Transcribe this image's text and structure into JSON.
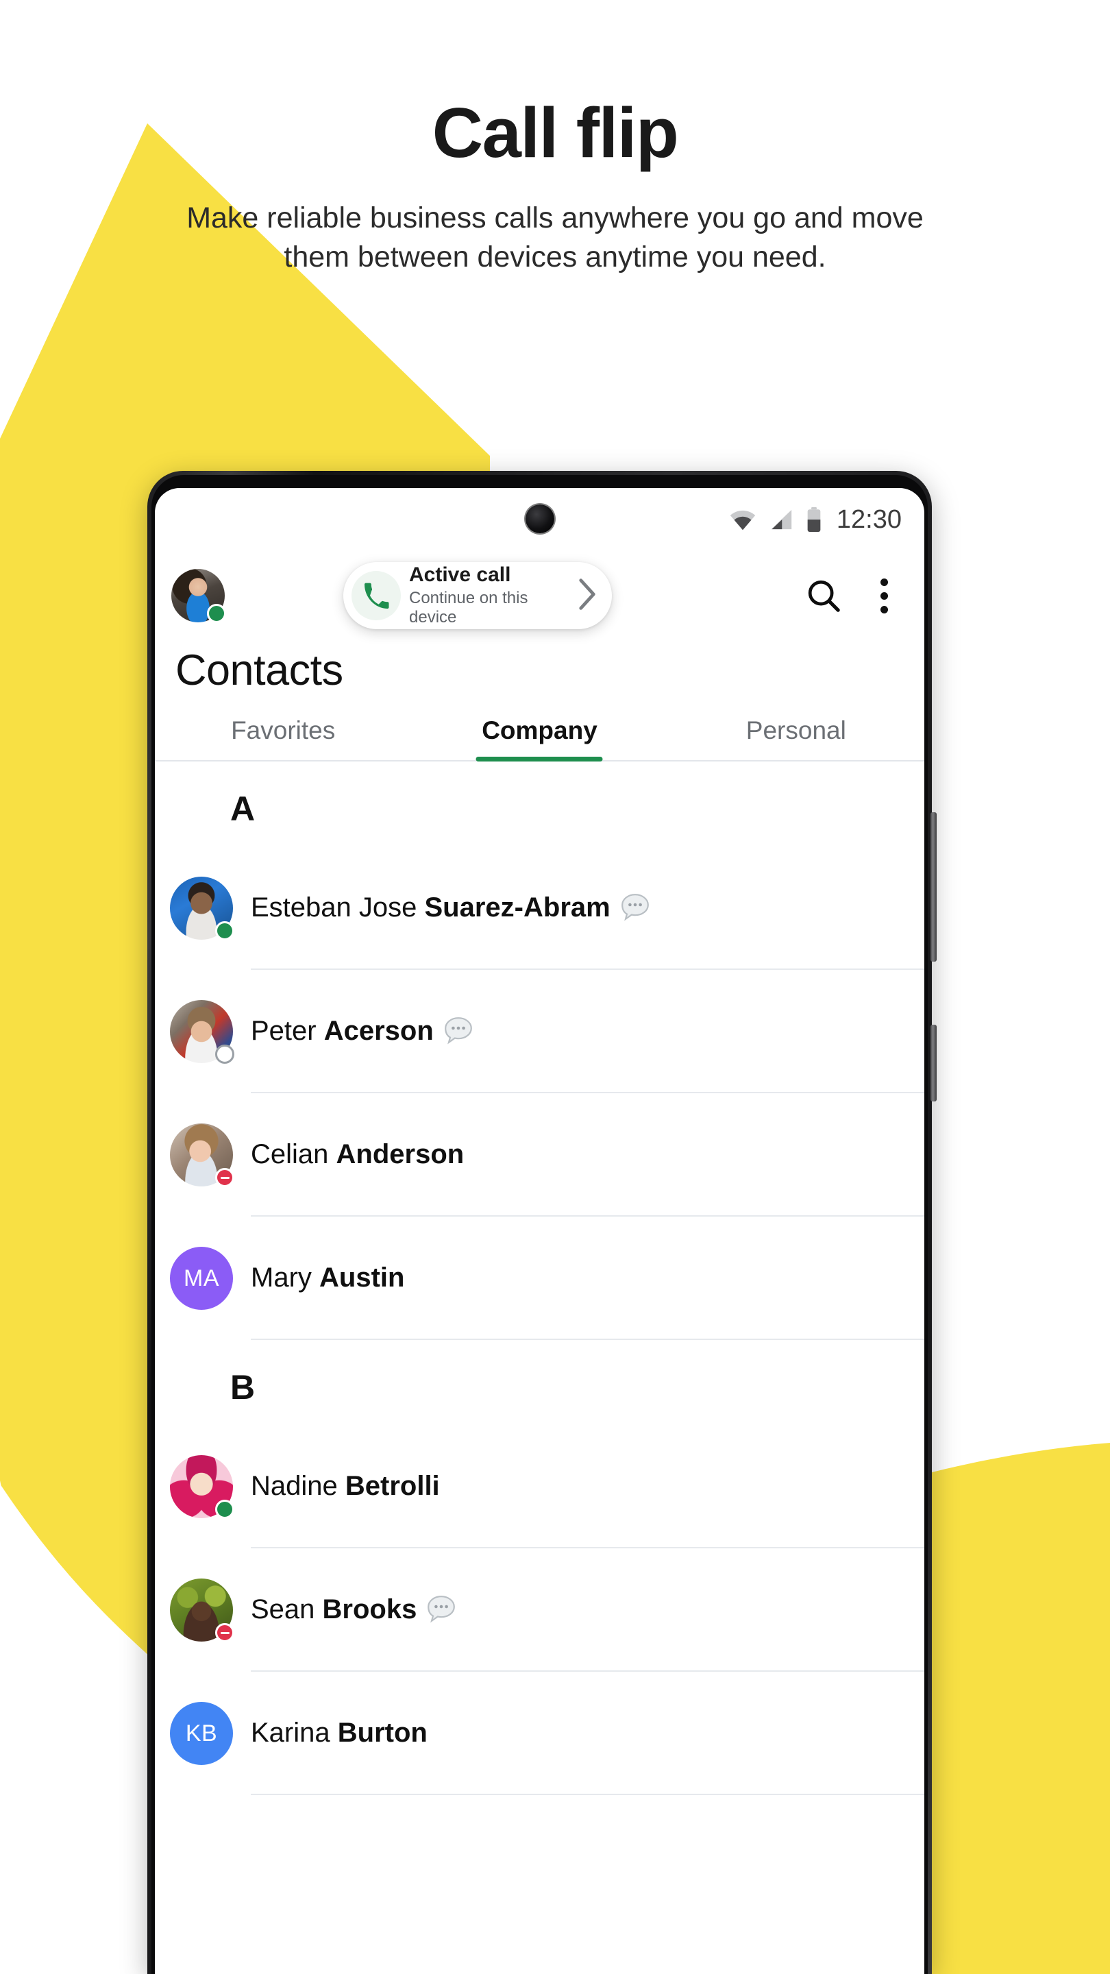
{
  "hero": {
    "title": "Call flip",
    "subtitle": "Make reliable business calls anywhere you go and move them between devices anytime you need."
  },
  "colors": {
    "accent_yellow": "#F8E044",
    "accent_green": "#1E8E4E",
    "text_primary": "#111111",
    "text_secondary": "#5F6368",
    "divider": "#E6E9ED",
    "dnd_red": "#E0324B"
  },
  "phone": {
    "status_bar": {
      "time": "12:30",
      "icons": [
        "wifi-icon",
        "cellular-signal-icon",
        "battery-icon"
      ],
      "battery_level": "50%"
    },
    "app_bar": {
      "profile_avatar": {
        "name": "me-avatar",
        "presence": "online"
      },
      "active_call_chip": {
        "icon": "phone-icon",
        "title": "Active call",
        "subtitle": "Continue on this device",
        "chevron": "chevron-right-icon"
      },
      "actions": [
        {
          "name": "search-icon",
          "label": "Search"
        },
        {
          "name": "more-vert-icon",
          "label": "More options"
        }
      ]
    },
    "page_title": "Contacts",
    "tabs": [
      {
        "label": "Favorites",
        "active": false
      },
      {
        "label": "Company",
        "active": true
      },
      {
        "label": "Personal",
        "active": false
      }
    ],
    "sections": [
      {
        "letter": "A",
        "contacts": [
          {
            "first": "Esteban Jose ",
            "last": "Suarez-Abram",
            "avatar_type": "photo",
            "avatar_key": "av-esteban",
            "presence": "online",
            "has_message_bubble": true
          },
          {
            "first": "Peter ",
            "last": "Acerson",
            "avatar_type": "photo",
            "avatar_key": "av-peter",
            "presence": "offline",
            "has_message_bubble": true
          },
          {
            "first": "Celian ",
            "last": "Anderson",
            "avatar_type": "photo",
            "avatar_key": "av-celian",
            "presence": "dnd",
            "has_message_bubble": false
          },
          {
            "first": "Mary ",
            "last": "Austin",
            "avatar_type": "initials",
            "initials": "MA",
            "avatar_color": "#8B5CF6",
            "presence": "none",
            "has_message_bubble": false
          }
        ]
      },
      {
        "letter": "B",
        "contacts": [
          {
            "first": "Nadine ",
            "last": "Betrolli",
            "avatar_type": "photo",
            "avatar_key": "av-nadine",
            "presence": "online",
            "has_message_bubble": false
          },
          {
            "first": "Sean ",
            "last": "Brooks",
            "avatar_type": "photo",
            "avatar_key": "av-sean",
            "presence": "dnd",
            "has_message_bubble": true
          },
          {
            "first": "Karina ",
            "last": "Burton",
            "avatar_type": "initials",
            "initials": "KB",
            "avatar_color": "#4285F4",
            "presence": "none",
            "has_message_bubble": false
          }
        ]
      }
    ]
  }
}
